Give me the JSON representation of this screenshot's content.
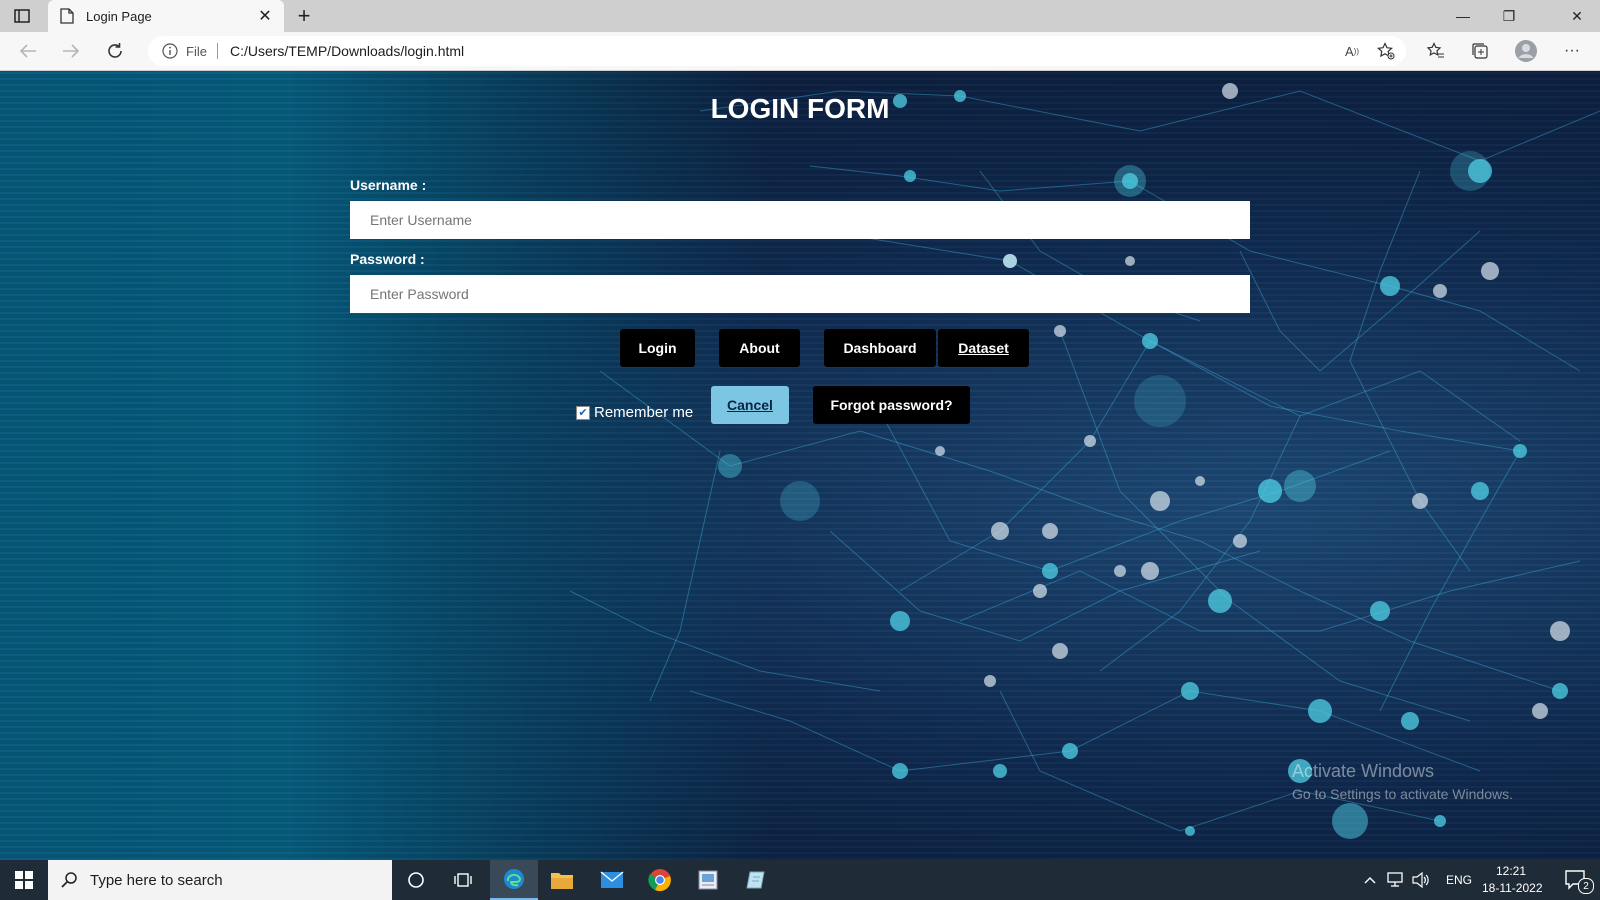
{
  "browser": {
    "tab_title": "Login Page",
    "scheme_label": "File",
    "url": "C:/Users/TEMP/Downloads/login.html"
  },
  "form": {
    "title": "LOGIN FORM",
    "username_label": "Username :",
    "username_placeholder": "Enter Username",
    "password_label": "Password :",
    "password_placeholder": "Enter Password",
    "remember_label": "Remember me",
    "remember_checked": true
  },
  "buttons": {
    "login": "Login",
    "about": "About",
    "dashboard": "Dashboard",
    "dataset": "Dataset",
    "cancel": "Cancel",
    "forgot": "Forgot password?"
  },
  "watermark": {
    "line1": "Activate Windows",
    "line2": "Go to Settings to activate Windows."
  },
  "taskbar": {
    "search_placeholder": "Type here to search",
    "language": "ENG",
    "time": "12:21",
    "date": "18-11-2022",
    "notification_count": "2"
  },
  "colors": {
    "cancel_button_bg": "#7cc6e4",
    "button_bg": "#000000",
    "page_left_teal": "#075a7e"
  },
  "icons": [
    "tab-actions-icon",
    "page-icon",
    "close-icon",
    "plus-icon",
    "back-icon",
    "forward-icon",
    "refresh-icon",
    "info-icon",
    "read-aloud-icon",
    "add-favorite-icon",
    "favorites-icon",
    "collections-icon",
    "profile-icon",
    "more-icon",
    "windows-start-icon",
    "search-icon",
    "cortana-icon",
    "task-view-icon",
    "edge-icon",
    "file-explorer-icon",
    "mail-icon",
    "chrome-icon",
    "app-icon",
    "notepad-icon",
    "chevron-up-icon",
    "network-icon",
    "volume-icon",
    "notification-icon"
  ]
}
